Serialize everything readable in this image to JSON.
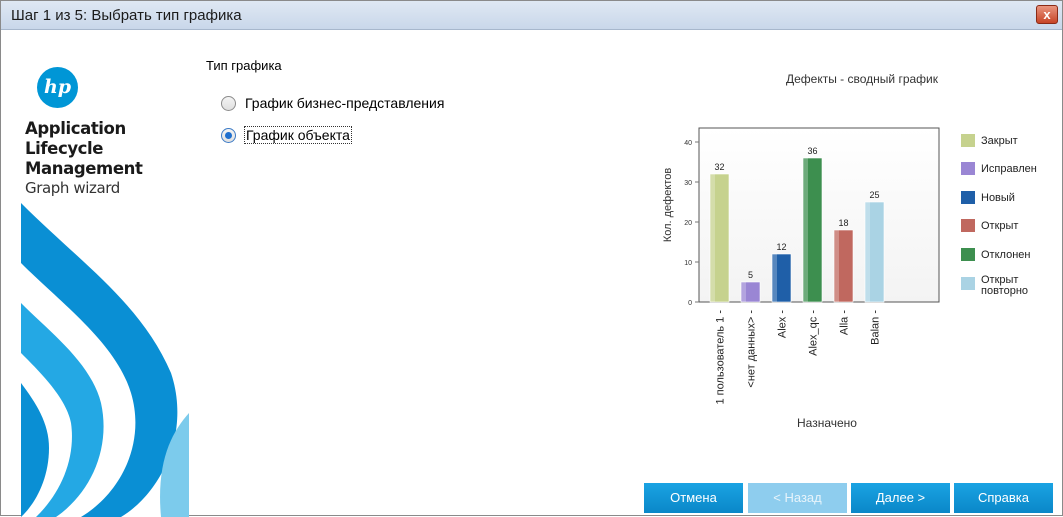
{
  "window": {
    "title": "Шаг 1 из 5: Выбрать тип графика",
    "close_glyph": "x"
  },
  "branding": {
    "logo_text": "hp",
    "line1": "Application",
    "line2": "Lifecycle",
    "line3": "Management",
    "line4": "Graph wizard"
  },
  "graph_type": {
    "label": "Тип графика",
    "options": [
      {
        "label": "График бизнес-представления",
        "checked": false
      },
      {
        "label": "График объекта",
        "checked": true
      }
    ]
  },
  "buttons": {
    "cancel": "Отмена",
    "back": "< Назад",
    "next": "Далее >",
    "help": "Справка"
  },
  "colors": {
    "accent": "#0a87c8",
    "titlebar": "#c9d7ea"
  },
  "chart_data": {
    "type": "bar",
    "title": "Дефекты - сводный график",
    "xlabel": "Назначено",
    "ylabel": "Кол. дефектов",
    "ylim": [
      0,
      40
    ],
    "yticks": [
      0,
      10,
      20,
      30,
      40
    ],
    "grid": false,
    "legend_position": "right",
    "categories": [
      "1 пользователь 1 -",
      "<нет данных> -",
      "Alex -",
      "Alex_qc -",
      "Alla -",
      "Balan -"
    ],
    "bars": [
      {
        "category": "1 пользователь 1 -",
        "value": 32,
        "series": "Закрыт"
      },
      {
        "category": "<нет данных> -",
        "value": 5,
        "series": "Исправлен"
      },
      {
        "category": "Alex -",
        "value": 12,
        "series": "Новый"
      },
      {
        "category": "Alex_qc -",
        "value": 36,
        "series": "Отклонен"
      },
      {
        "category": "Alla -",
        "value": 18,
        "series": "Открыт"
      },
      {
        "category": "Balan -",
        "value": 25,
        "series": "Открыт повторно"
      }
    ],
    "legend": [
      {
        "name": "Закрыт",
        "color": "#c6d28e"
      },
      {
        "name": "Исправлен",
        "color": "#9a86d4"
      },
      {
        "name": "Новый",
        "color": "#1f5fa8"
      },
      {
        "name": "Открыт",
        "color": "#c0685f"
      },
      {
        "name": "Отклонен",
        "color": "#3d8f4f"
      },
      {
        "name": "Открыт повторно",
        "color": "#aad3e4"
      }
    ]
  }
}
